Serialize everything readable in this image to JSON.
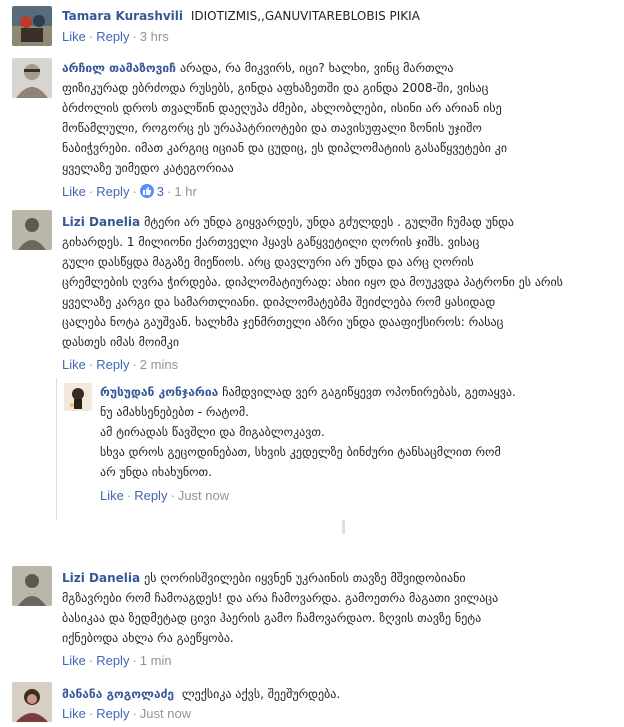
{
  "comments": [
    {
      "author": "Tamara Kurashvili",
      "text": "IDIOTIZMIS,,GANUVITAREBLOBIS PIKIA",
      "like_label": "Like",
      "reply_label": "Reply",
      "time": "3 hrs",
      "avatar_icon": "profile-photo"
    },
    {
      "author": "არჩილ თამაზოვიჩ",
      "lines": [
        "არადა, რა მიკვირს, იცი? ხალხი, ვინც მართლა",
        "ფიზიკურად ებრძოდა რუსებს, გინდა აფხაზეთში და გინდა 2008-ში, ვისაც",
        "ბრძოლის დროს თვალწინ დაეღუპა ძმები, ახლობლები, ისინი არ არიან ისე",
        "მოწამლული, როგორც ეს ურაპატრიოტები და თავისუფალი ზონის უჯიშო",
        "ნაბიჭვრები. იმათ კარგიც იციან და ცუდიც, ეს დიპლომატიის გასაწყვეტები კი",
        "ყველაზე უიმედო კატეგორიაა"
      ],
      "like_label": "Like",
      "reply_label": "Reply",
      "reaction_count": "3",
      "time": "1 hr",
      "avatar_icon": "profile-photo"
    },
    {
      "author": "Lizi Danelia",
      "lines": [
        "მტერი არ უნდა გიყვარდეს, უნდა გძულდეს . გულში ჩუმად უნდა",
        "გიხარდეს. 1 მილიონი ქართველი ჰყავს გაწყვეტილი ღორის ჯიშს. ვისაც",
        "გული დასწყდა მაგაზე მიეწიოს. არც დავლური არ უნდა და არც ღორის",
        "ცრემლების ღვრა ჭირდება. დიპლომატიურად: ახიი იყო და მოუკვდა პატრონი ეს არის",
        "ყველაზე კარგი და სამართლიანი. დიპლომატებმა შეიძლება რომ ყასიდად",
        "ცალება ნოტა გაუშვან. ხალხმა ჯენმრთელი აზრი უნდა დააფიქსიროს: რასაც",
        "დასთეს იმას მოიმკი"
      ],
      "like_label": "Like",
      "reply_label": "Reply",
      "time": "2 mins",
      "avatar_icon": "profile-photo"
    },
    {
      "author": "რუსუდან კონჯარია",
      "lines": [
        "ჩამდვილად ვერ გაგიწყევთ ოპონირებას, გეთაყვა.",
        "ნუ ამახსენებებთ - რატომ.",
        "ამ ტირადას წავშლი და მიგაბლოკავთ.",
        "სხვა დროს გეცოდინებათ, სხვის კედელზე ბინძური ტანსაცმლით რომ",
        "არ უნდა იხახუნოთ."
      ],
      "like_label": "Like",
      "reply_label": "Reply",
      "time": "Just now",
      "avatar_icon": "profile-photo"
    },
    {
      "author": "Lizi Danelia",
      "lines": [
        "ეს ღორისშვილები იყვნენ უკრაინის თავზე მშვიდობიანი",
        "მგზავრები რომ ჩამოაგდეს! და არა ჩამოვარდა. გამოეთრა მაგათი ვილაცა",
        "ბასიკაა და ზედმეტად ცივი ჰაერის გამო ჩამოვარდაო. ზღვის თავზე ნეტა",
        "იქნებოდა ახლა რა გაეწყობა."
      ],
      "like_label": "Like",
      "reply_label": "Reply",
      "time": "1 min",
      "avatar_icon": "profile-photo"
    },
    {
      "author": "მანანა გოგოლაძე",
      "text": "ლექსიკა აქვს, შეეშურდება.",
      "like_label": "Like",
      "reply_label": "Reply",
      "time": "Just now",
      "avatar_icon": "profile-photo"
    }
  ],
  "colors": {
    "link": "#4267b2",
    "author": "#365899",
    "muted": "#90949c",
    "text": "#1d2129",
    "like_badge": "#5890ff"
  }
}
